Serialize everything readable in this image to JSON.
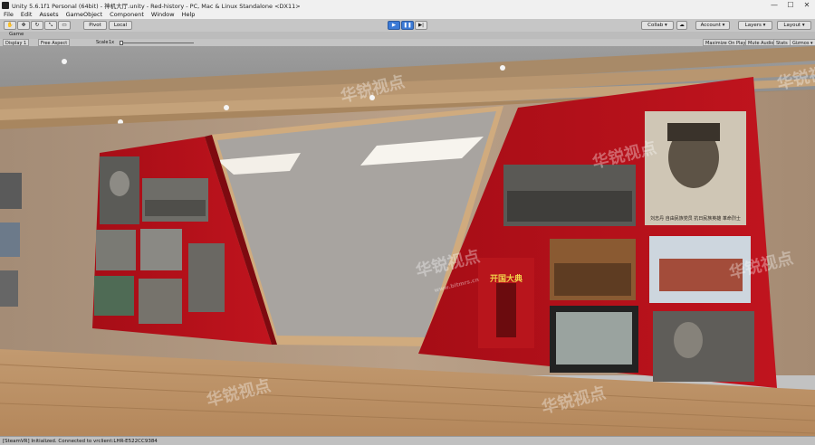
{
  "window": {
    "title": "Unity 5.6.1f1 Personal (64bit) - 神机大厅.unity - Red-history - PC, Mac & Linux Standalone <DX11>",
    "minimize": "—",
    "maximize": "☐",
    "close": "✕"
  },
  "menu": [
    "File",
    "Edit",
    "Assets",
    "GameObject",
    "Component",
    "Window",
    "Help"
  ],
  "toolbar": {
    "pivot": "Pivot",
    "local": "Local",
    "collab": "Collab ▾",
    "account": "Account ▾",
    "layers": "Layers ▾",
    "layout": "Layout ▾"
  },
  "game_tab": {
    "label": "Game"
  },
  "game_toolbar": {
    "display": "Display 1",
    "aspect": "Free Aspect",
    "scale_label": "Scale",
    "scale_value": "1x",
    "maximize_on_play": "Maximize On Play",
    "mute_audio": "Mute Audio",
    "stats": "Stats",
    "gizmos": "Gizmos ▾"
  },
  "scene": {
    "poster_caption": "开国大典",
    "portrait_caption": "刘志丹 自由民族党员 抗日民族英雄 革命烈士",
    "watermark_text": "华锐视点",
    "watermark_url": "www.bitmrs.cn"
  },
  "status": {
    "text": "[SteamVR] Initialized. Connected to vrclient:LHR-E522CC9384"
  },
  "colors": {
    "editor_bg": "#c2c2c2",
    "panel_red": "#b8101a",
    "play_blue": "#3b7ad6",
    "wall": "#b39a83",
    "floor": "#c8a074"
  }
}
